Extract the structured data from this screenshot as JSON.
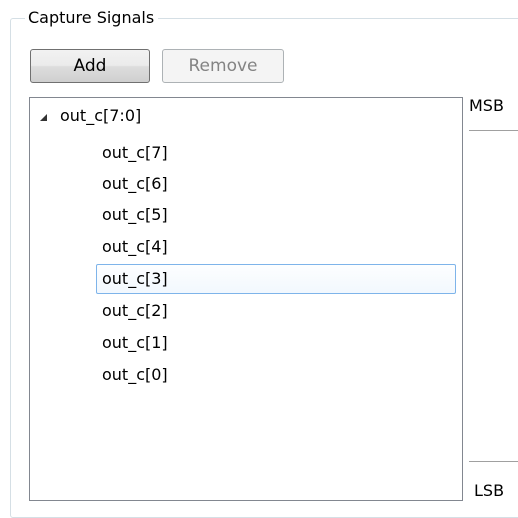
{
  "group": {
    "title": "Capture Signals"
  },
  "toolbar": {
    "add_label": "Add",
    "remove_label": "Remove"
  },
  "tree": {
    "parent": {
      "label": "out_c[7:0]",
      "expanded": true,
      "expander_icon": "triangle-expanded-icon"
    },
    "children": [
      {
        "label": "out_c[7]",
        "selected": false
      },
      {
        "label": "out_c[6]",
        "selected": false
      },
      {
        "label": "out_c[5]",
        "selected": false
      },
      {
        "label": "out_c[4]",
        "selected": false
      },
      {
        "label": "out_c[3]",
        "selected": true
      },
      {
        "label": "out_c[2]",
        "selected": false
      },
      {
        "label": "out_c[1]",
        "selected": false
      },
      {
        "label": "out_c[0]",
        "selected": false
      }
    ]
  },
  "bit_order": {
    "msb_label": "MSB",
    "lsb_label": "LSB"
  },
  "colors": {
    "selection_border": "#7eb4ea",
    "disabled_text": "#838383"
  }
}
